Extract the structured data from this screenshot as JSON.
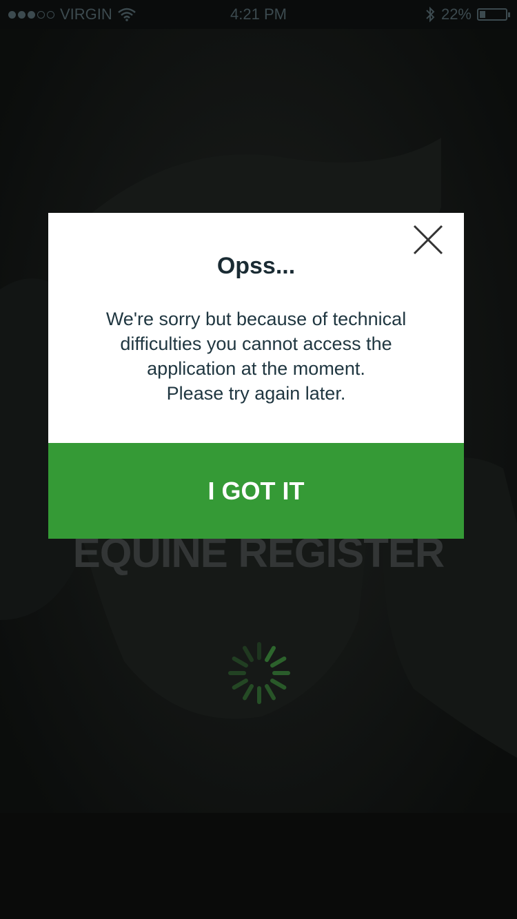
{
  "status_bar": {
    "carrier": "VIRGIN",
    "time": "4:21 PM",
    "battery_percent": "22%",
    "battery_level": 0.22,
    "signal_bars_filled": 3,
    "signal_bars_total": 5,
    "icons": [
      "wifi-icon",
      "bluetooth-icon",
      "battery-icon"
    ]
  },
  "background": {
    "app_title": "EQUINE REGISTER",
    "loading_spinner_color": "#2f6b2f"
  },
  "modal": {
    "title": "Opss...",
    "message": "We're sorry but because of  technical\ndifficulties  you cannot access the\napplication at the  moment.\nPlease try again  later.",
    "button_label": "I GOT IT",
    "close_icon": "close-icon",
    "button_color": "#359a36"
  }
}
